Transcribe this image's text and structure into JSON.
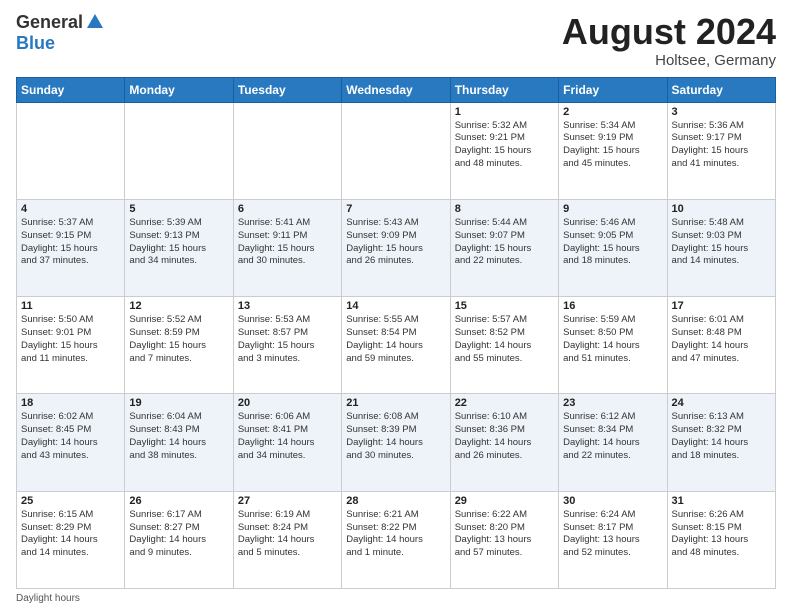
{
  "header": {
    "logo_line1": "General",
    "logo_line2": "Blue",
    "month_year": "August 2024",
    "location": "Holtsee, Germany"
  },
  "footer": {
    "daylight_label": "Daylight hours"
  },
  "weekdays": [
    "Sunday",
    "Monday",
    "Tuesday",
    "Wednesday",
    "Thursday",
    "Friday",
    "Saturday"
  ],
  "weeks": [
    [
      {
        "day": "",
        "info": ""
      },
      {
        "day": "",
        "info": ""
      },
      {
        "day": "",
        "info": ""
      },
      {
        "day": "",
        "info": ""
      },
      {
        "day": "1",
        "info": "Sunrise: 5:32 AM\nSunset: 9:21 PM\nDaylight: 15 hours\nand 48 minutes."
      },
      {
        "day": "2",
        "info": "Sunrise: 5:34 AM\nSunset: 9:19 PM\nDaylight: 15 hours\nand 45 minutes."
      },
      {
        "day": "3",
        "info": "Sunrise: 5:36 AM\nSunset: 9:17 PM\nDaylight: 15 hours\nand 41 minutes."
      }
    ],
    [
      {
        "day": "4",
        "info": "Sunrise: 5:37 AM\nSunset: 9:15 PM\nDaylight: 15 hours\nand 37 minutes."
      },
      {
        "day": "5",
        "info": "Sunrise: 5:39 AM\nSunset: 9:13 PM\nDaylight: 15 hours\nand 34 minutes."
      },
      {
        "day": "6",
        "info": "Sunrise: 5:41 AM\nSunset: 9:11 PM\nDaylight: 15 hours\nand 30 minutes."
      },
      {
        "day": "7",
        "info": "Sunrise: 5:43 AM\nSunset: 9:09 PM\nDaylight: 15 hours\nand 26 minutes."
      },
      {
        "day": "8",
        "info": "Sunrise: 5:44 AM\nSunset: 9:07 PM\nDaylight: 15 hours\nand 22 minutes."
      },
      {
        "day": "9",
        "info": "Sunrise: 5:46 AM\nSunset: 9:05 PM\nDaylight: 15 hours\nand 18 minutes."
      },
      {
        "day": "10",
        "info": "Sunrise: 5:48 AM\nSunset: 9:03 PM\nDaylight: 15 hours\nand 14 minutes."
      }
    ],
    [
      {
        "day": "11",
        "info": "Sunrise: 5:50 AM\nSunset: 9:01 PM\nDaylight: 15 hours\nand 11 minutes."
      },
      {
        "day": "12",
        "info": "Sunrise: 5:52 AM\nSunset: 8:59 PM\nDaylight: 15 hours\nand 7 minutes."
      },
      {
        "day": "13",
        "info": "Sunrise: 5:53 AM\nSunset: 8:57 PM\nDaylight: 15 hours\nand 3 minutes."
      },
      {
        "day": "14",
        "info": "Sunrise: 5:55 AM\nSunset: 8:54 PM\nDaylight: 14 hours\nand 59 minutes."
      },
      {
        "day": "15",
        "info": "Sunrise: 5:57 AM\nSunset: 8:52 PM\nDaylight: 14 hours\nand 55 minutes."
      },
      {
        "day": "16",
        "info": "Sunrise: 5:59 AM\nSunset: 8:50 PM\nDaylight: 14 hours\nand 51 minutes."
      },
      {
        "day": "17",
        "info": "Sunrise: 6:01 AM\nSunset: 8:48 PM\nDaylight: 14 hours\nand 47 minutes."
      }
    ],
    [
      {
        "day": "18",
        "info": "Sunrise: 6:02 AM\nSunset: 8:45 PM\nDaylight: 14 hours\nand 43 minutes."
      },
      {
        "day": "19",
        "info": "Sunrise: 6:04 AM\nSunset: 8:43 PM\nDaylight: 14 hours\nand 38 minutes."
      },
      {
        "day": "20",
        "info": "Sunrise: 6:06 AM\nSunset: 8:41 PM\nDaylight: 14 hours\nand 34 minutes."
      },
      {
        "day": "21",
        "info": "Sunrise: 6:08 AM\nSunset: 8:39 PM\nDaylight: 14 hours\nand 30 minutes."
      },
      {
        "day": "22",
        "info": "Sunrise: 6:10 AM\nSunset: 8:36 PM\nDaylight: 14 hours\nand 26 minutes."
      },
      {
        "day": "23",
        "info": "Sunrise: 6:12 AM\nSunset: 8:34 PM\nDaylight: 14 hours\nand 22 minutes."
      },
      {
        "day": "24",
        "info": "Sunrise: 6:13 AM\nSunset: 8:32 PM\nDaylight: 14 hours\nand 18 minutes."
      }
    ],
    [
      {
        "day": "25",
        "info": "Sunrise: 6:15 AM\nSunset: 8:29 PM\nDaylight: 14 hours\nand 14 minutes."
      },
      {
        "day": "26",
        "info": "Sunrise: 6:17 AM\nSunset: 8:27 PM\nDaylight: 14 hours\nand 9 minutes."
      },
      {
        "day": "27",
        "info": "Sunrise: 6:19 AM\nSunset: 8:24 PM\nDaylight: 14 hours\nand 5 minutes."
      },
      {
        "day": "28",
        "info": "Sunrise: 6:21 AM\nSunset: 8:22 PM\nDaylight: 14 hours\nand 1 minute."
      },
      {
        "day": "29",
        "info": "Sunrise: 6:22 AM\nSunset: 8:20 PM\nDaylight: 13 hours\nand 57 minutes."
      },
      {
        "day": "30",
        "info": "Sunrise: 6:24 AM\nSunset: 8:17 PM\nDaylight: 13 hours\nand 52 minutes."
      },
      {
        "day": "31",
        "info": "Sunrise: 6:26 AM\nSunset: 8:15 PM\nDaylight: 13 hours\nand 48 minutes."
      }
    ]
  ]
}
